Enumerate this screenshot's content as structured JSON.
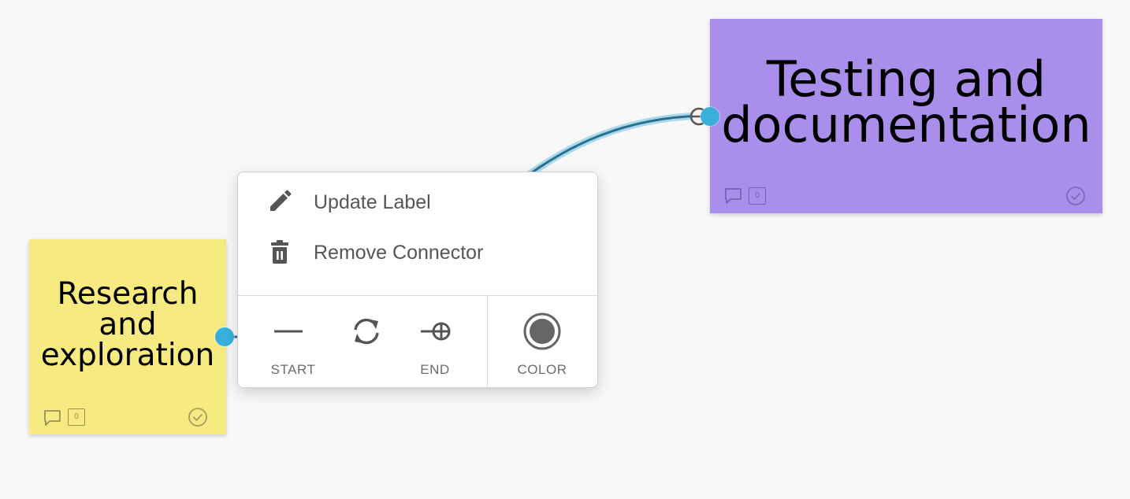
{
  "canvas": {
    "background": "#f8f8f8",
    "stickies": [
      {
        "id": "research",
        "text": "Research and exploration",
        "lines": [
          "Research",
          "and",
          "exploration"
        ],
        "color": "#f7ea80",
        "comment_count": "0"
      },
      {
        "id": "testing",
        "text": "Testing and documentation",
        "lines": [
          "Testing and",
          "documentation"
        ],
        "color": "#aa8eeb",
        "comment_count": "0"
      }
    ],
    "connector": {
      "color": "#37b0dc",
      "line_color": "#2b6f8e"
    }
  },
  "context_menu": {
    "items": [
      {
        "label": "Update Label",
        "icon": "pencil-icon"
      },
      {
        "label": "Remove Connector",
        "icon": "trash-icon"
      }
    ],
    "tools": {
      "start_label": "START",
      "swap_icon": "swap-icon",
      "end_label": "END",
      "color_label": "COLOR",
      "current_color": "#666666"
    }
  }
}
